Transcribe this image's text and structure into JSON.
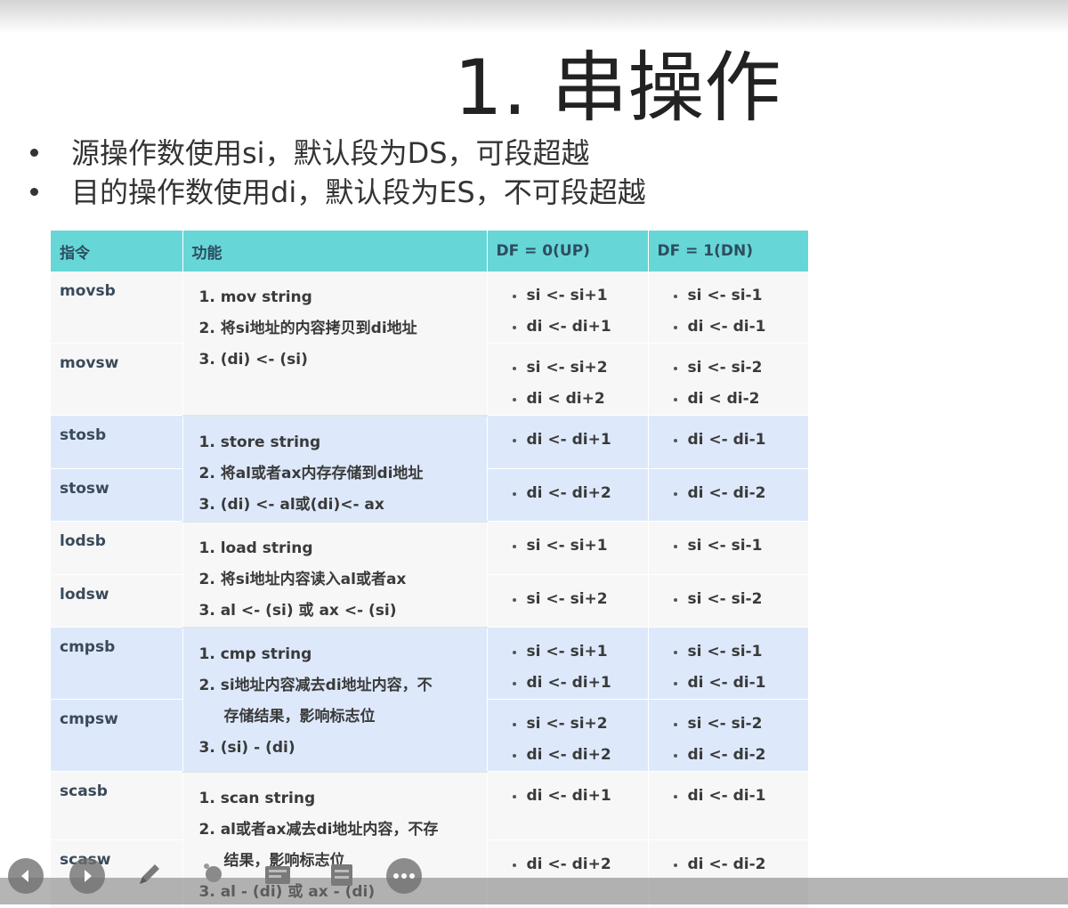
{
  "slide": {
    "title": "1. 串操作",
    "bullets": [
      "源操作数使用si，默认段为DS，可段超越",
      "目的操作数使用di，默认段为ES，不可段超越"
    ]
  },
  "table": {
    "headers": [
      "指令",
      "功能",
      "DF = 0(UP)",
      "DF = 1(DN)"
    ],
    "groups": [
      {
        "shade": "white",
        "rows": [
          {
            "instr": "movsb",
            "up": [
              "si <- si+1",
              "di <- di+1"
            ],
            "dn": [
              "si <- si-1",
              "di <- di-1"
            ]
          },
          {
            "instr": "movsw",
            "up": [
              "si <- si+2",
              "di < di+2"
            ],
            "dn": [
              "si <- si-2",
              "di < di-2"
            ]
          }
        ],
        "func": [
          "1. mov string",
          "2. 将si地址的内容拷贝到di地址",
          "3. (di) <- (si)"
        ]
      },
      {
        "shade": "blue",
        "rows": [
          {
            "instr": "stosb",
            "up": [
              "di <- di+1"
            ],
            "dn": [
              "di <- di-1"
            ]
          },
          {
            "instr": "stosw",
            "up": [
              "di <- di+2"
            ],
            "dn": [
              "di <- di-2"
            ]
          }
        ],
        "func": [
          "1. store string",
          "2. 将al或者ax内存存储到di地址",
          "3. (di) <- al或(di)<- ax"
        ]
      },
      {
        "shade": "white",
        "rows": [
          {
            "instr": "lodsb",
            "up": [
              "si <- si+1"
            ],
            "dn": [
              "si <- si-1"
            ]
          },
          {
            "instr": "lodsw",
            "up": [
              "si <- si+2"
            ],
            "dn": [
              "si <- si-2"
            ]
          }
        ],
        "func": [
          "1. load string",
          "2. 将si地址内容读入al或者ax",
          "3. al <- (si) 或 ax <- (si)"
        ]
      },
      {
        "shade": "blue",
        "rows": [
          {
            "instr": "cmpsb",
            "up": [
              "si <- si+1",
              "di <- di+1"
            ],
            "dn": [
              "si <- si-1",
              "di <- di-1"
            ]
          },
          {
            "instr": "cmpsw",
            "up": [
              "si <- si+2",
              "di <- di+2"
            ],
            "dn": [
              "si <- si-2",
              "di <- di-2"
            ]
          }
        ],
        "func": [
          "1. cmp string",
          "2. si地址内容减去di地址内容，不",
          "存储结果，影响标志位",
          "3. (si) - (di)"
        ]
      },
      {
        "shade": "white",
        "rows": [
          {
            "instr": "scasb",
            "up": [
              "di <- di+1"
            ],
            "dn": [
              "di <- di-1"
            ]
          },
          {
            "instr": "scasw",
            "up": [
              "di <- di+2"
            ],
            "dn": [
              "di <- di-2"
            ]
          }
        ],
        "func": [
          "1. scan string",
          "2. al或者ax减去di地址内容，不存",
          "结果，影响标志位",
          "3. al - (di) 或 ax - (di)"
        ]
      }
    ]
  },
  "toolbar": {
    "buttons": [
      "back-icon",
      "forward-icon",
      "pen-icon",
      "pointer-icon",
      "slides-icon",
      "notes-icon",
      "more-icon"
    ]
  }
}
